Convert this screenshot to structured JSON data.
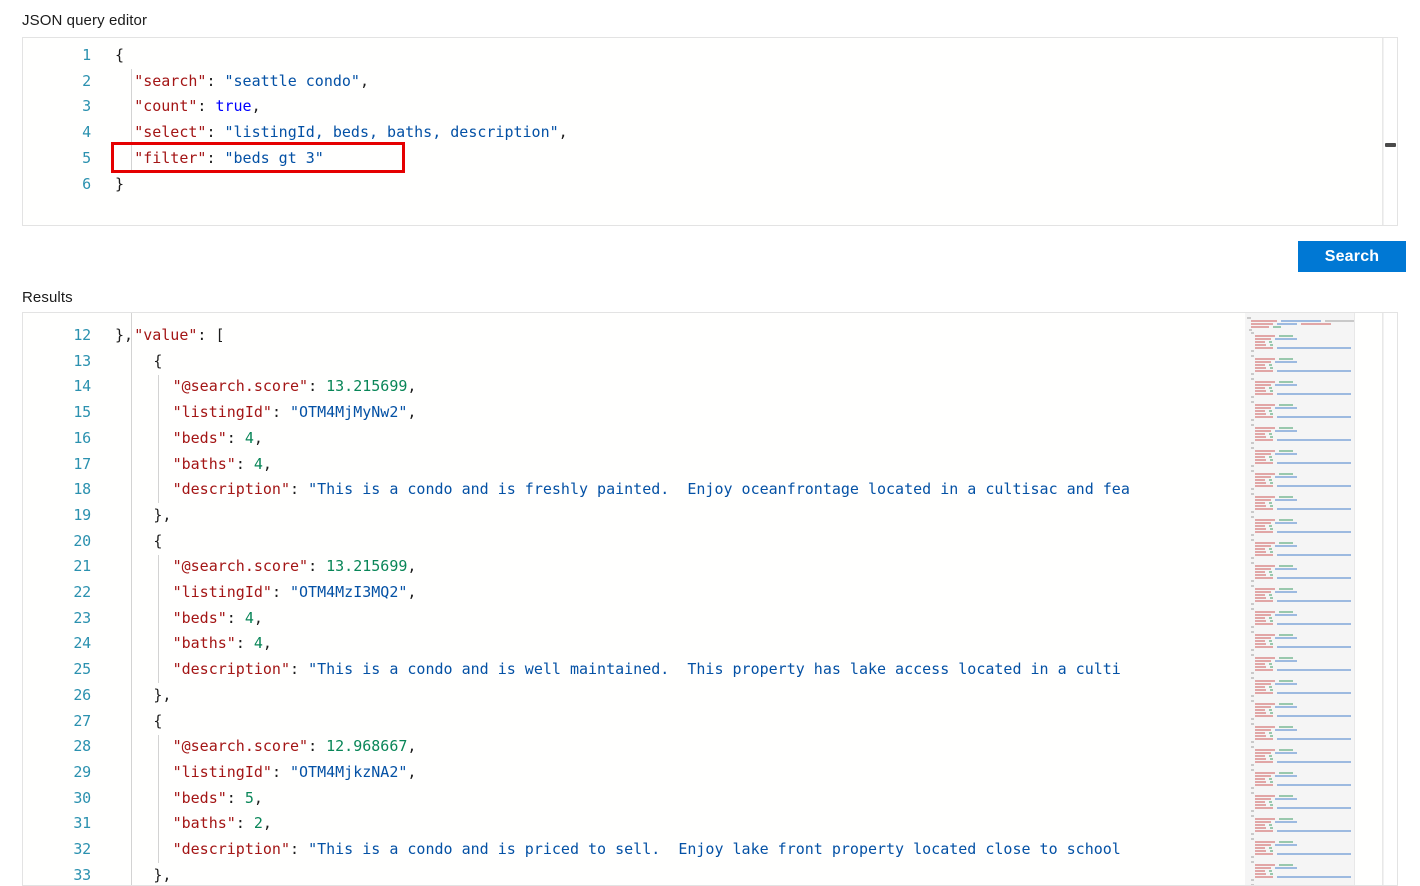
{
  "query_editor": {
    "label": "JSON query editor",
    "lines": [
      {
        "num": "1",
        "indent": 0,
        "tokens": [
          {
            "t": "punc",
            "v": "{"
          }
        ]
      },
      {
        "num": "2",
        "indent": 1,
        "tokens": [
          {
            "t": "key",
            "v": "\"search\""
          },
          {
            "t": "punc",
            "v": ": "
          },
          {
            "t": "str",
            "v": "\"seattle condo\""
          },
          {
            "t": "punc",
            "v": ","
          }
        ]
      },
      {
        "num": "3",
        "indent": 1,
        "tokens": [
          {
            "t": "key",
            "v": "\"count\""
          },
          {
            "t": "punc",
            "v": ": "
          },
          {
            "t": "bool",
            "v": "true"
          },
          {
            "t": "punc",
            "v": ","
          }
        ]
      },
      {
        "num": "4",
        "indent": 1,
        "tokens": [
          {
            "t": "key",
            "v": "\"select\""
          },
          {
            "t": "punc",
            "v": ": "
          },
          {
            "t": "str",
            "v": "\"listingId, beds, baths, description\""
          },
          {
            "t": "punc",
            "v": ","
          }
        ]
      },
      {
        "num": "5",
        "indent": 1,
        "tokens": [
          {
            "t": "key",
            "v": "\"filter\""
          },
          {
            "t": "punc",
            "v": ": "
          },
          {
            "t": "str",
            "v": "\"beds gt 3\""
          }
        ]
      },
      {
        "num": "6",
        "indent": 0,
        "tokens": [
          {
            "t": "punc",
            "v": "}"
          }
        ]
      }
    ],
    "highlight_note": "filter line highlighted with red rectangle",
    "current_line": "4"
  },
  "search_button": {
    "label": "Search",
    "color": "#0078d4"
  },
  "results": {
    "label": "Results",
    "partial_top_line": "},",
    "lines": [
      {
        "num": "12",
        "indent": 1,
        "tokens": [
          {
            "t": "key",
            "v": "\"value\""
          },
          {
            "t": "punc",
            "v": ": ["
          }
        ]
      },
      {
        "num": "13",
        "indent": 2,
        "tokens": [
          {
            "t": "punc",
            "v": "{"
          }
        ]
      },
      {
        "num": "14",
        "indent": 3,
        "tokens": [
          {
            "t": "key",
            "v": "\"@search.score\""
          },
          {
            "t": "punc",
            "v": ": "
          },
          {
            "t": "num",
            "v": "13.215699"
          },
          {
            "t": "punc",
            "v": ","
          }
        ]
      },
      {
        "num": "15",
        "indent": 3,
        "tokens": [
          {
            "t": "key",
            "v": "\"listingId\""
          },
          {
            "t": "punc",
            "v": ": "
          },
          {
            "t": "str",
            "v": "\"OTM4MjMyNw2\""
          },
          {
            "t": "punc",
            "v": ","
          }
        ]
      },
      {
        "num": "16",
        "indent": 3,
        "tokens": [
          {
            "t": "key",
            "v": "\"beds\""
          },
          {
            "t": "punc",
            "v": ": "
          },
          {
            "t": "num",
            "v": "4"
          },
          {
            "t": "punc",
            "v": ","
          }
        ]
      },
      {
        "num": "17",
        "indent": 3,
        "tokens": [
          {
            "t": "key",
            "v": "\"baths\""
          },
          {
            "t": "punc",
            "v": ": "
          },
          {
            "t": "num",
            "v": "4"
          },
          {
            "t": "punc",
            "v": ","
          }
        ]
      },
      {
        "num": "18",
        "indent": 3,
        "tokens": [
          {
            "t": "key",
            "v": "\"description\""
          },
          {
            "t": "punc",
            "v": ": "
          },
          {
            "t": "str",
            "v": "\"This is a condo and is freshly painted.  Enjoy oceanfrontage located in a cultisac and fea"
          }
        ]
      },
      {
        "num": "19",
        "indent": 2,
        "tokens": [
          {
            "t": "punc",
            "v": "},"
          }
        ]
      },
      {
        "num": "20",
        "indent": 2,
        "tokens": [
          {
            "t": "punc",
            "v": "{"
          }
        ]
      },
      {
        "num": "21",
        "indent": 3,
        "tokens": [
          {
            "t": "key",
            "v": "\"@search.score\""
          },
          {
            "t": "punc",
            "v": ": "
          },
          {
            "t": "num",
            "v": "13.215699"
          },
          {
            "t": "punc",
            "v": ","
          }
        ]
      },
      {
        "num": "22",
        "indent": 3,
        "tokens": [
          {
            "t": "key",
            "v": "\"listingId\""
          },
          {
            "t": "punc",
            "v": ": "
          },
          {
            "t": "str",
            "v": "\"OTM4MzI3MQ2\""
          },
          {
            "t": "punc",
            "v": ","
          }
        ]
      },
      {
        "num": "23",
        "indent": 3,
        "tokens": [
          {
            "t": "key",
            "v": "\"beds\""
          },
          {
            "t": "punc",
            "v": ": "
          },
          {
            "t": "num",
            "v": "4"
          },
          {
            "t": "punc",
            "v": ","
          }
        ]
      },
      {
        "num": "24",
        "indent": 3,
        "tokens": [
          {
            "t": "key",
            "v": "\"baths\""
          },
          {
            "t": "punc",
            "v": ": "
          },
          {
            "t": "num",
            "v": "4"
          },
          {
            "t": "punc",
            "v": ","
          }
        ]
      },
      {
        "num": "25",
        "indent": 3,
        "tokens": [
          {
            "t": "key",
            "v": "\"description\""
          },
          {
            "t": "punc",
            "v": ": "
          },
          {
            "t": "str",
            "v": "\"This is a condo and is well maintained.  This property has lake access located in a culti"
          }
        ]
      },
      {
        "num": "26",
        "indent": 2,
        "tokens": [
          {
            "t": "punc",
            "v": "},"
          }
        ]
      },
      {
        "num": "27",
        "indent": 2,
        "tokens": [
          {
            "t": "punc",
            "v": "{"
          }
        ]
      },
      {
        "num": "28",
        "indent": 3,
        "tokens": [
          {
            "t": "key",
            "v": "\"@search.score\""
          },
          {
            "t": "punc",
            "v": ": "
          },
          {
            "t": "num",
            "v": "12.968667"
          },
          {
            "t": "punc",
            "v": ","
          }
        ]
      },
      {
        "num": "29",
        "indent": 3,
        "tokens": [
          {
            "t": "key",
            "v": "\"listingId\""
          },
          {
            "t": "punc",
            "v": ": "
          },
          {
            "t": "str",
            "v": "\"OTM4MjkzNA2\""
          },
          {
            "t": "punc",
            "v": ","
          }
        ]
      },
      {
        "num": "30",
        "indent": 3,
        "tokens": [
          {
            "t": "key",
            "v": "\"beds\""
          },
          {
            "t": "punc",
            "v": ": "
          },
          {
            "t": "num",
            "v": "5"
          },
          {
            "t": "punc",
            "v": ","
          }
        ]
      },
      {
        "num": "31",
        "indent": 3,
        "tokens": [
          {
            "t": "key",
            "v": "\"baths\""
          },
          {
            "t": "punc",
            "v": ": "
          },
          {
            "t": "num",
            "v": "2"
          },
          {
            "t": "punc",
            "v": ","
          }
        ]
      },
      {
        "num": "32",
        "indent": 3,
        "tokens": [
          {
            "t": "key",
            "v": "\"description\""
          },
          {
            "t": "punc",
            "v": ": "
          },
          {
            "t": "str",
            "v": "\"This is a condo and is priced to sell.  Enjoy lake front property located close to school"
          }
        ]
      },
      {
        "num": "33",
        "indent": 2,
        "tokens": [
          {
            "t": "punc",
            "v": "},"
          }
        ]
      }
    ]
  }
}
